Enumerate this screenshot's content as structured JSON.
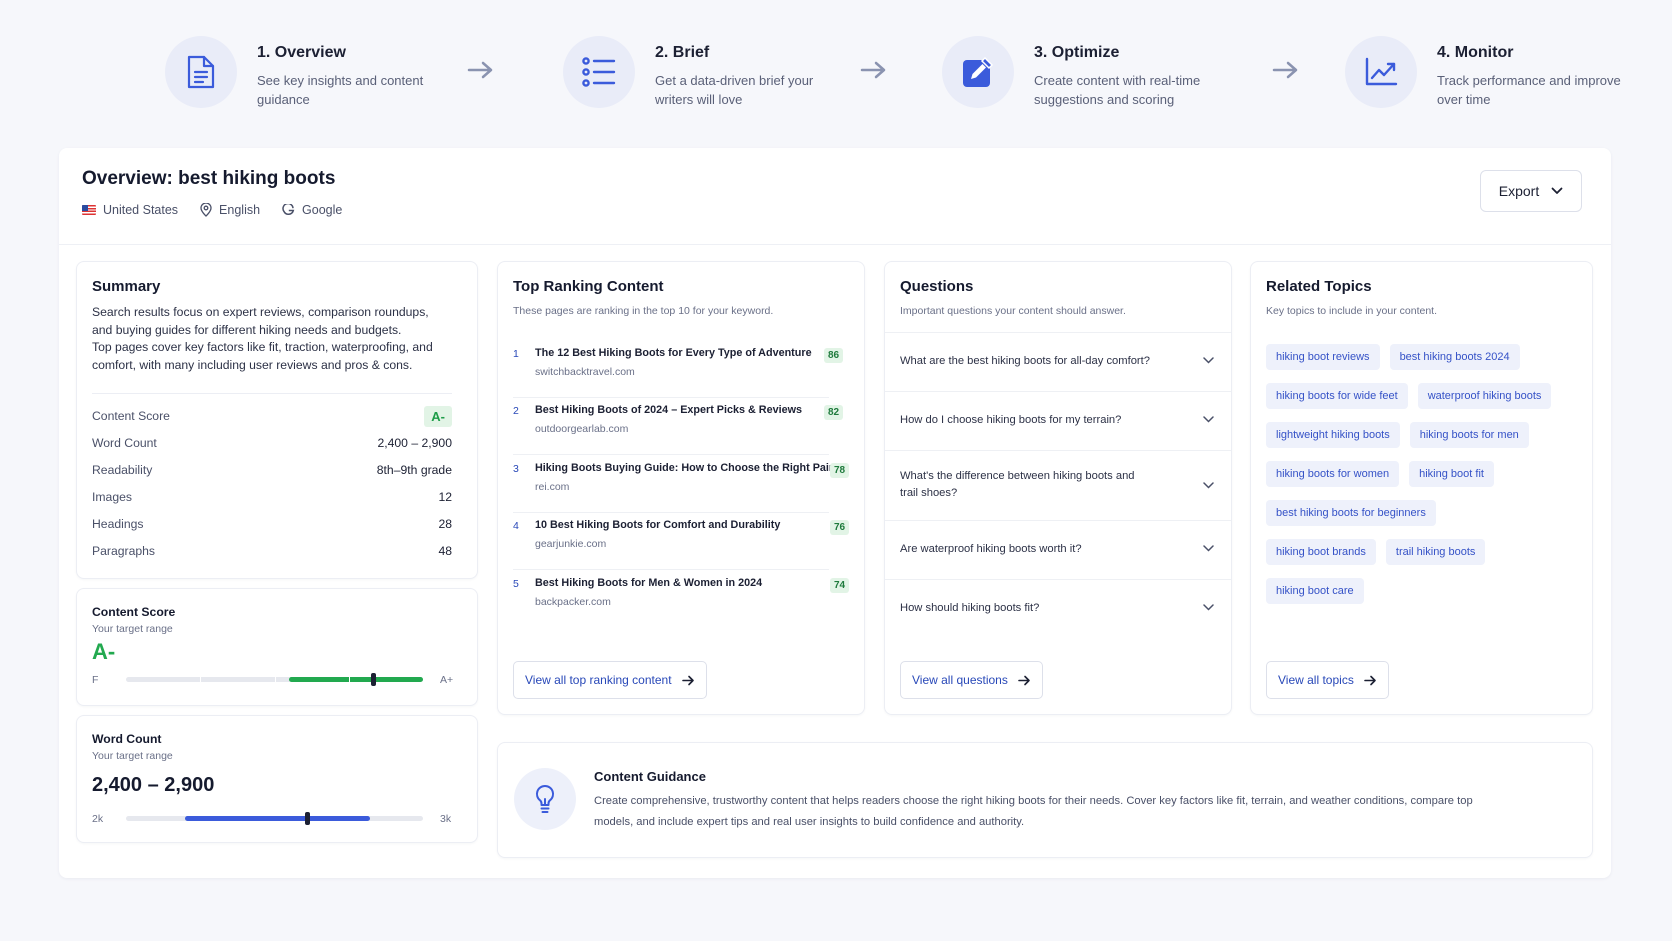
{
  "steps": [
    {
      "title": "1. Overview",
      "desc": "See key insights and content guidance",
      "icon": "document-icon"
    },
    {
      "title": "2. Brief",
      "desc": "Get a data-driven brief your writers will love",
      "icon": "list-icon"
    },
    {
      "title": "3. Optimize",
      "desc": "Create content with real-time suggestions and scoring",
      "icon": "edit-icon"
    },
    {
      "title": "4. Monitor",
      "desc": "Track performance and improve over time",
      "icon": "chart-line-icon"
    }
  ],
  "overview": {
    "title": "Overview: best hiking boots",
    "country": "United States",
    "language": "English",
    "engine": "Google",
    "export_label": "Export"
  },
  "summary": {
    "title": "Summary",
    "text1": "Search results focus on expert reviews, comparison roundups, and buying guides for different hiking needs and budgets.",
    "text2": "Top pages cover key factors like fit, traction, waterproofing, and comfort, with many including user reviews and pros & cons.",
    "stats": [
      {
        "label": "Content Score",
        "value": "A-"
      },
      {
        "label": "Word Count",
        "value": "2,400 – 2,900"
      },
      {
        "label": "Readability",
        "value": "8th–9th grade"
      },
      {
        "label": "Images",
        "value": "12"
      },
      {
        "label": "Headings",
        "value": "28"
      },
      {
        "label": "Paragraphs",
        "value": "48"
      }
    ]
  },
  "content_score": {
    "title": "Content Score",
    "subtitle": "Your target range",
    "grade": "A-",
    "min_label": "F",
    "max_label": "A+",
    "range_start": 0.55,
    "range_end": 1.0,
    "marker": 0.83,
    "color": "#22a94f"
  },
  "word_count": {
    "title": "Word Count",
    "subtitle": "Your target range",
    "value": "2,400 – 2,900",
    "min_label": "2k",
    "max_label": "3k",
    "range_start": 0.2,
    "range_end": 0.82,
    "marker": 0.61,
    "color": "#3b5bdb"
  },
  "top_ranking": {
    "title": "Top Ranking Content",
    "subtitle": "These pages are ranking in the top 10 for your keyword.",
    "items": [
      {
        "rank": "1",
        "title": "The 12 Best Hiking Boots for Every Type of Adventure",
        "domain": "switchbacktravel.com",
        "score": "86"
      },
      {
        "rank": "2",
        "title": "Best Hiking Boots of 2024 – Expert Picks & Reviews",
        "domain": "outdoorgearlab.com",
        "score": "82"
      },
      {
        "rank": "3",
        "title": "Hiking Boots Buying Guide: How to Choose the Right Pair",
        "domain": "rei.com",
        "score": "78"
      },
      {
        "rank": "4",
        "title": "10 Best Hiking Boots for Comfort and Durability",
        "domain": "gearjunkie.com",
        "score": "76"
      },
      {
        "rank": "5",
        "title": "Best Hiking Boots for Men & Women in 2024",
        "domain": "backpacker.com",
        "score": "74"
      }
    ],
    "view_all": "View all top ranking content"
  },
  "questions": {
    "title": "Questions",
    "subtitle": "Important questions your content should answer.",
    "items": [
      "What are the best hiking boots for all-day comfort?",
      "How do I choose hiking boots for my terrain?",
      "What's the difference between hiking boots and trail shoes?",
      "Are waterproof hiking boots worth it?",
      "How should hiking boots fit?"
    ],
    "view_all": "View all questions"
  },
  "related": {
    "title": "Related Topics",
    "subtitle": "Key topics to include in your content.",
    "chips": [
      [
        "hiking boot reviews",
        "best hiking boots 2024"
      ],
      [
        "hiking boots for wide feet",
        "waterproof hiking boots"
      ],
      [
        "lightweight hiking boots",
        "hiking boots for men"
      ],
      [
        "hiking boots for women",
        "hiking boot fit"
      ],
      [
        "best hiking boots for beginners"
      ],
      [
        "hiking boot brands",
        "trail hiking boots"
      ],
      [
        "hiking boot care"
      ]
    ],
    "view_all": "View all topics"
  },
  "guidance": {
    "title": "Content Guidance",
    "text": "Create comprehensive, trustworthy content that helps readers choose the right hiking boots for their needs. Cover key factors like fit, terrain, and weather conditions, compare top models, and include expert tips and real user insights to build confidence and authority."
  },
  "colors": {
    "accent": "#3552c7",
    "success": "#22a94f",
    "background": "#f6f7fb"
  }
}
